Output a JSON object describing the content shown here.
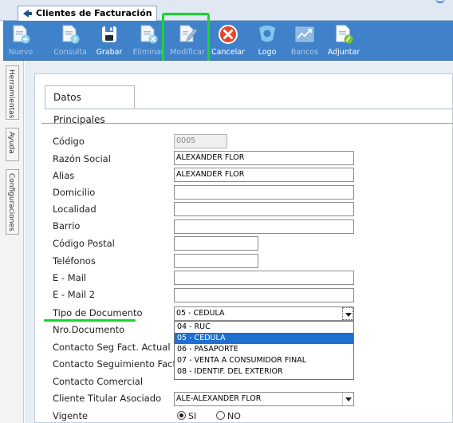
{
  "window": {
    "tab_title": "Clientes de Facturación"
  },
  "toolbar": {
    "buttons": [
      {
        "label": "Nuevo",
        "icon": "document-add-icon",
        "enabled": false
      },
      {
        "label": "Consulta",
        "icon": "document-help-icon",
        "enabled": false
      },
      {
        "label": "Grabar",
        "icon": "save-icon",
        "enabled": true
      },
      {
        "label": "Eliminar",
        "icon": "document-delete-icon",
        "enabled": false
      },
      {
        "label": "Modificar",
        "icon": "edit-pencil-icon",
        "enabled": false
      },
      {
        "label": "Cancelar",
        "icon": "cancel-icon",
        "enabled": true
      },
      {
        "label": "Logo",
        "icon": "logo-icon",
        "enabled": true
      },
      {
        "label": "Bancos",
        "icon": "chart-icon",
        "enabled": false
      },
      {
        "label": "Adjuntar",
        "icon": "attach-document-icon",
        "enabled": true
      }
    ]
  },
  "side_tabs": [
    "Herramientas",
    "Ayuda",
    "Configuraciones"
  ],
  "form": {
    "tab_label": "Datos Principales",
    "fields": [
      {
        "label": "Código",
        "value": "0005"
      },
      {
        "label": "Razón Social",
        "value": "ALEXANDER FLOR"
      },
      {
        "label": "Alias",
        "value": "ALEXANDER FLOR"
      },
      {
        "label": "Domicilio",
        "value": ""
      },
      {
        "label": "Localidad",
        "value": ""
      },
      {
        "label": "Barrio",
        "value": ""
      },
      {
        "label": "Código Postal",
        "value": ""
      },
      {
        "label": "Teléfonos",
        "value": ""
      },
      {
        "label": "E - Mail",
        "value": ""
      },
      {
        "label": "E - Mail 2",
        "value": ""
      },
      {
        "label": "Tipo de Documento",
        "value": "05 - CEDULA"
      },
      {
        "label": "Nro.Documento",
        "value": ""
      },
      {
        "label": "Contacto Seg Fact. Actual",
        "value": ""
      },
      {
        "label": "Contacto Seguimiento Fact.",
        "value": ""
      },
      {
        "label": "Contacto Comercial",
        "value": ""
      },
      {
        "label": "Cliente Titular Asociado",
        "value": "ALE-ALEXANDER FLOR"
      },
      {
        "label": "Vigente",
        "value": ""
      }
    ],
    "tipo_documento_options": [
      "04 - RUC",
      "05 - CEDULA",
      "06 - PASAPORTE",
      "07 - VENTA A CONSUMIDOR FINAL",
      "08 - IDENTIF. DEL EXTERIOR"
    ],
    "tipo_documento_selected_index": 1,
    "vigente_options": [
      "SI",
      "NO"
    ]
  },
  "colors": {
    "toolbar_bg": "#3f82c9",
    "highlight": "#18d62c",
    "selection": "#1e6fd0"
  }
}
